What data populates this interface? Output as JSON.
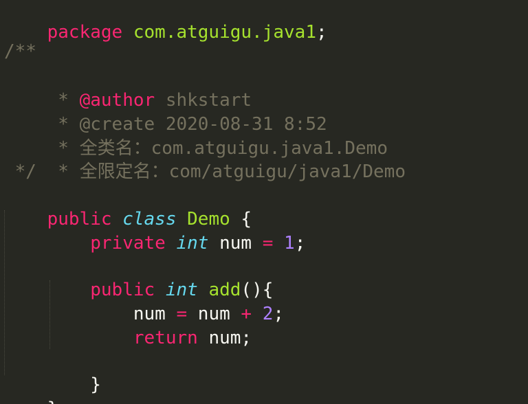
{
  "code": {
    "package_kw": "package",
    "package_name": "com.atguigu.java1",
    "semicolon": ";",
    "comment_open": "/**",
    "comment_star": " * ",
    "author_tag": "@author",
    "author_value": " shkstart",
    "create_line": "@create 2020-08-31 8:52",
    "fullname_line": "全类名：com.atguigu.java1.Demo",
    "qualified_line": "全限定名：com/atguigu/java1/Demo",
    "comment_close": " */",
    "public_kw": "public",
    "class_kw": "class",
    "class_name": "Demo",
    "open_brace": "{",
    "private_kw": "private",
    "int_kw": "int",
    "field_name": "num",
    "assign_op": "=",
    "field_value": "1",
    "method_name": "add",
    "method_parens": "()",
    "var_num": "num",
    "plus_op": "+",
    "add_value": "2",
    "return_kw": "return",
    "return_value": "num;",
    "close_brace": "}"
  }
}
